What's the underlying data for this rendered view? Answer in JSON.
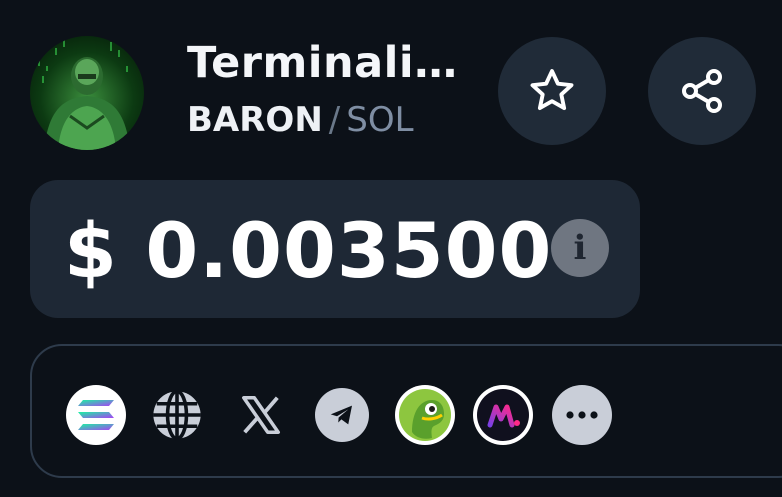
{
  "token": {
    "name": "Terminali…",
    "symbol": "BARON",
    "separator": "/",
    "quote": "SOL"
  },
  "price": {
    "display": "$ 0.003500",
    "info_glyph": "i"
  },
  "actions": {
    "favorite_icon": "star-icon",
    "share_icon": "share-icon"
  },
  "links": [
    {
      "icon": "solana-icon"
    },
    {
      "icon": "globe-icon"
    },
    {
      "icon": "x-twitter-icon"
    },
    {
      "icon": "telegram-icon"
    },
    {
      "icon": "coingecko-icon"
    },
    {
      "icon": "moralis-icon"
    },
    {
      "icon": "more-icon"
    }
  ],
  "colors": {
    "background": "#0c1118",
    "card": "#1e2835",
    "button": "#202b38",
    "muted": "#7f8ea3"
  }
}
